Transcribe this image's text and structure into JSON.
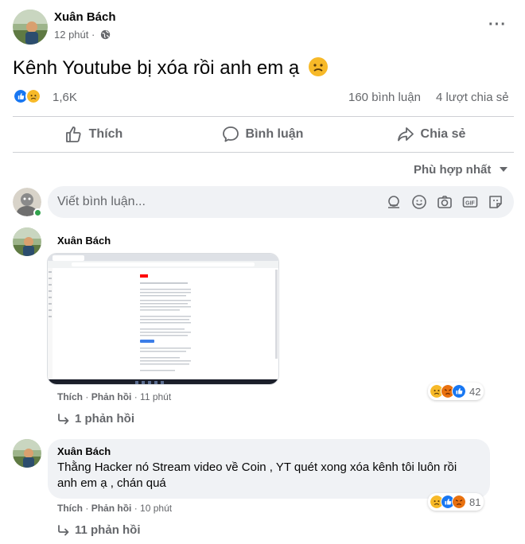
{
  "post": {
    "author": "Xuân Bách",
    "time": "12 phút",
    "text": "Kênh Youtube bị xóa rồi anh em ạ",
    "reaction_count": "1,6K",
    "comments_count": "160 bình luận",
    "shares_count": "4 lượt chia sẻ"
  },
  "actions": {
    "like": "Thích",
    "comment": "Bình luận",
    "share": "Chia sẻ"
  },
  "sort_label": "Phù hợp nhất",
  "comment_input": {
    "placeholder": "Viết bình luận..."
  },
  "comments": [
    {
      "author": "Xuân Bách",
      "text": "",
      "like": "Thích",
      "reply": "Phản hồi",
      "time": "11 phút",
      "reaction_count": "42",
      "replies": "1 phản hồi"
    },
    {
      "author": "Xuân Bách",
      "text": "Thằng Hacker nó Stream video về Coin , YT quét xong xóa kênh tôi luôn rồi anh em ạ , chán quá",
      "like": "Thích",
      "reply": "Phản hồi",
      "time": "10 phút",
      "reaction_count": "81",
      "replies": "11 phản hồi"
    }
  ],
  "colors": {
    "like_blue": "#1877f2",
    "sad_yellow": "#f7b928",
    "angry_orange": "#e9710f",
    "muted": "#65676b"
  }
}
